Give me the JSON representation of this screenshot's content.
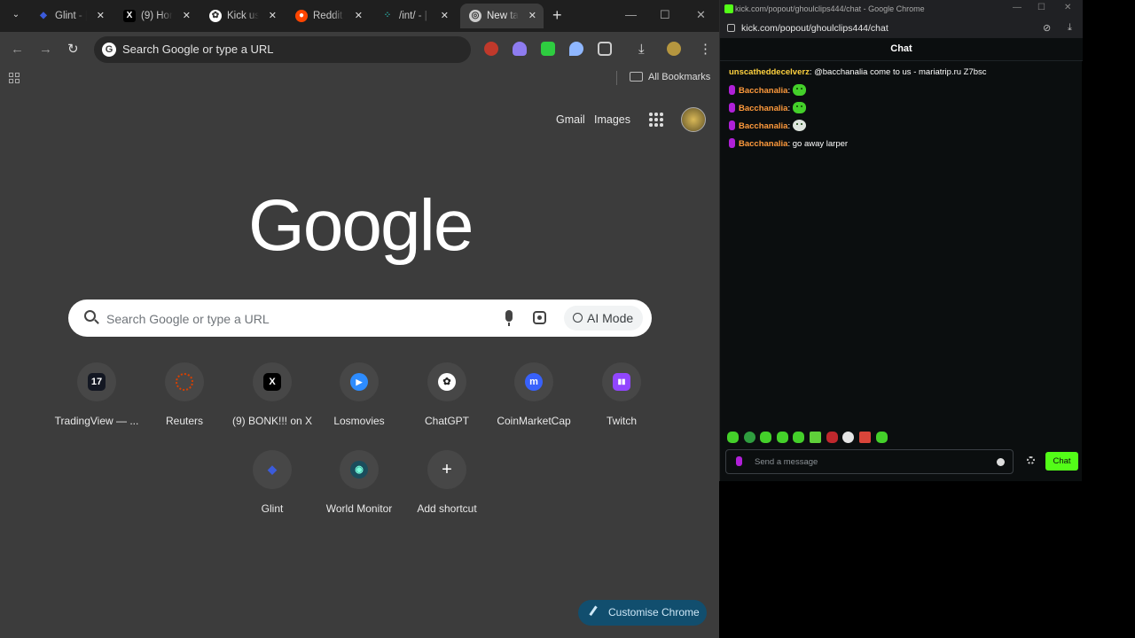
{
  "browser": {
    "tabs": [
      {
        "label": "Glint - |",
        "favicon": "glint-icon",
        "color": "#3b5bdb"
      },
      {
        "label": "(9) Hon",
        "favicon": "x-icon",
        "color": "#000000"
      },
      {
        "label": "Kick us",
        "favicon": "chatgpt-icon",
        "color": "#ffffff"
      },
      {
        "label": "Reddit",
        "favicon": "reddit-icon",
        "color": "#ff4500"
      },
      {
        "label": "/int/ - |",
        "favicon": "4chan-icon",
        "color": "#2aa198"
      },
      {
        "label": "New ta",
        "favicon": "chrome-icon",
        "color": "#cccccc"
      }
    ],
    "omnibox_placeholder": "Search Google or type a URL",
    "all_bookmarks_label": "All Bookmarks"
  },
  "ntp": {
    "gmail_label": "Gmail",
    "images_label": "Images",
    "logo_text": "Google",
    "search_placeholder": "Search Google or type a URL",
    "ai_mode_label": "AI Mode",
    "shortcuts": [
      {
        "label": "TradingView — ...",
        "icon": "tradingview-icon",
        "icon_text": "17",
        "color": "#131722"
      },
      {
        "label": "Reuters",
        "icon": "reuters-icon",
        "icon_text": "",
        "color": "#d64000"
      },
      {
        "label": "(9) BONK!!! on X",
        "icon": "x-icon",
        "icon_text": "X",
        "color": "#000000"
      },
      {
        "label": "Losmovies",
        "icon": "losmovies-icon",
        "icon_text": "▶",
        "color": "#2d8cff"
      },
      {
        "label": "ChatGPT",
        "icon": "chatgpt-icon",
        "icon_text": "✿",
        "color": "#ffffff"
      },
      {
        "label": "CoinMarketCap",
        "icon": "coinmarketcap-icon",
        "icon_text": "m",
        "color": "#3861fb"
      },
      {
        "label": "Twitch",
        "icon": "twitch-icon",
        "icon_text": "▮▮",
        "color": "#9146ff"
      },
      {
        "label": "Glint",
        "icon": "glint-icon",
        "icon_text": "◆",
        "color": "#3b5bdb"
      },
      {
        "label": "World Monitor",
        "icon": "world-monitor-icon",
        "icon_text": "◉",
        "color": "#1b4d5c"
      },
      {
        "label": "Add shortcut",
        "icon": "plus-icon",
        "icon_text": "+",
        "color": "#474747"
      }
    ],
    "customise_label": "Customise Chrome"
  },
  "kick": {
    "window_title": "kick.com/popout/ghoulclips444/chat - Google Chrome",
    "url": "kick.com/popout/ghoulclips444/chat",
    "header": "Chat",
    "messages": [
      {
        "user": "unscathеddecelverz",
        "user_color": "#ffd23f",
        "badge": false,
        "text": ": @bacchanalia come to us - mariatrip.ru Z7bsc",
        "emote": false
      },
      {
        "user": "Bacchanalia",
        "user_color": "#ff9a3c",
        "badge": true,
        "text": ":",
        "emote": true
      },
      {
        "user": "Bacchanalia",
        "user_color": "#ff9a3c",
        "badge": true,
        "text": ":",
        "emote": true
      },
      {
        "user": "Bacchanalia",
        "user_color": "#ff9a3c",
        "badge": true,
        "text": ":",
        "emote": true
      },
      {
        "user": "Bacchanalia",
        "user_color": "#ff9a3c",
        "badge": true,
        "text": ": go away larper",
        "emote": false
      }
    ],
    "input_placeholder": "Send a message",
    "send_label": "Chat",
    "accent": "#53fc18"
  }
}
